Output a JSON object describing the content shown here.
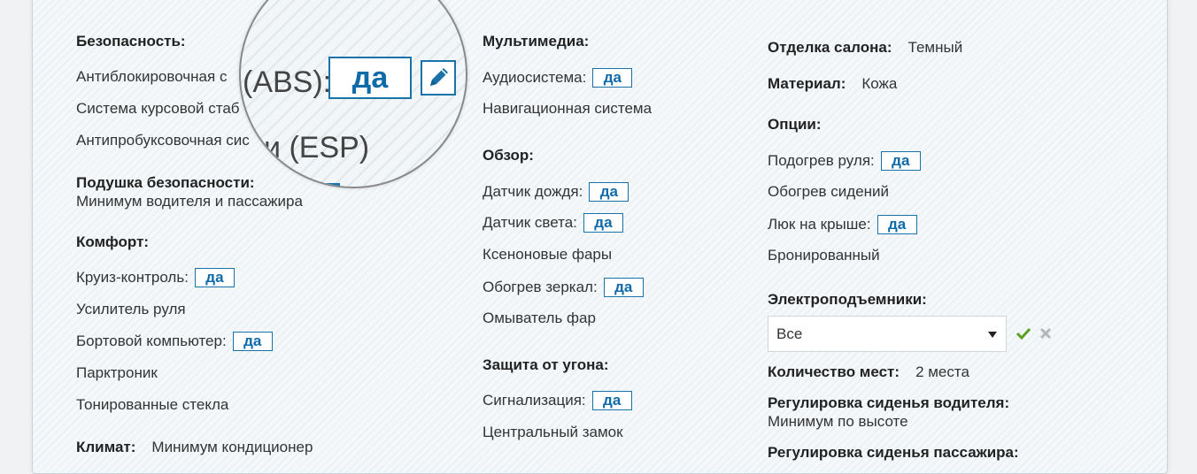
{
  "colors": {
    "accent": "#1a73a8",
    "confirm": "#5a9e22",
    "cancel": "#b5b5b5"
  },
  "yes_label": "да",
  "col1": {
    "safety_heading": "Безопасность:",
    "safety_items": [
      "Антиблокировочная с",
      "Система курсовой стаб",
      "Антипробуксовочная сис"
    ],
    "airbag_heading": "Подушка безопасности:",
    "airbag_value": "Минимум водителя и пассажира",
    "comfort_heading": "Комфорт:",
    "comfort_items": [
      "Круиз-контроль:",
      "Усилитель руля",
      "Бортовой компьютер:",
      "Парктроник",
      "Тонированные стекла"
    ],
    "climate_label": "Климат:",
    "climate_value": "Минимум кондиционер"
  },
  "magnifier": {
    "abs_text": "(ABS):",
    "esp_text": "и (ESP)",
    "edit_icon": "pencil-icon"
  },
  "col2": {
    "multimedia_heading": "Мультимедиа:",
    "multimedia_items": [
      "Аудиосистема:",
      "Навигационная система"
    ],
    "view_heading": "Обзор:",
    "view_items": [
      "Датчик дождя:",
      "Датчик света:",
      "Ксеноновые фары",
      "Обогрев зеркал:",
      "Омыватель фар"
    ],
    "theft_heading": "Защита от угона:",
    "theft_items": [
      "Сигнализация:",
      "Центральный замок"
    ]
  },
  "col3": {
    "trim_label": "Отделка салона:",
    "trim_value": "Темный",
    "material_label": "Материал:",
    "material_value": "Кожа",
    "options_heading": "Опции:",
    "options_items": [
      "Подогрев руля:",
      "Обогрев сидений",
      "Люк на крыше:",
      "Бронированный"
    ],
    "windows_heading": "Электроподъемники:",
    "windows_selected": "Все",
    "seats_label": "Количество мест:",
    "seats_value": "2 места",
    "driver_seat_heading": "Регулировка сиденья водителя:",
    "driver_seat_value": "Минимум по высоте",
    "passenger_seat_heading": "Регулировка сиденья пассажира:"
  }
}
